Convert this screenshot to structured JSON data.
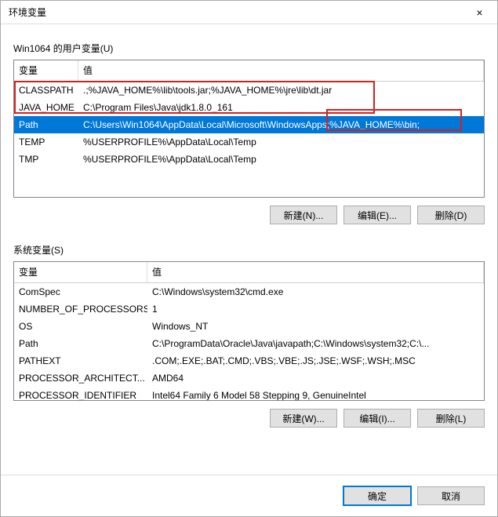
{
  "window": {
    "title": "环境变量",
    "close": "×"
  },
  "user_section": {
    "label": "Win1064 的用户变量(U)",
    "col_var": "变量",
    "col_val": "值",
    "rows": [
      {
        "var": "CLASSPATH",
        "val": ".;%JAVA_HOME%\\lib\\tools.jar;%JAVA_HOME%\\jre\\lib\\dt.jar",
        "selected": false
      },
      {
        "var": "JAVA_HOME",
        "val": "C:\\Program Files\\Java\\jdk1.8.0_161",
        "selected": false
      },
      {
        "var": "Path",
        "val": "C:\\Users\\Win1064\\AppData\\Local\\Microsoft\\WindowsApps;%JAVA_HOME%\\bin;",
        "selected": true
      },
      {
        "var": "TEMP",
        "val": "%USERPROFILE%\\AppData\\Local\\Temp",
        "selected": false
      },
      {
        "var": "TMP",
        "val": "%USERPROFILE%\\AppData\\Local\\Temp",
        "selected": false
      }
    ],
    "buttons": {
      "new": "新建(N)...",
      "edit": "编辑(E)...",
      "delete": "删除(D)"
    }
  },
  "system_section": {
    "label": "系统变量(S)",
    "col_var": "变量",
    "col_val": "值",
    "rows": [
      {
        "var": "ComSpec",
        "val": "C:\\Windows\\system32\\cmd.exe"
      },
      {
        "var": "NUMBER_OF_PROCESSORS",
        "val": "1"
      },
      {
        "var": "OS",
        "val": "Windows_NT"
      },
      {
        "var": "Path",
        "val": "C:\\ProgramData\\Oracle\\Java\\javapath;C:\\Windows\\system32;C:\\..."
      },
      {
        "var": "PATHEXT",
        "val": ".COM;.EXE;.BAT;.CMD;.VBS;.VBE;.JS;.JSE;.WSF;.WSH;.MSC"
      },
      {
        "var": "PROCESSOR_ARCHITECT...",
        "val": "AMD64"
      },
      {
        "var": "PROCESSOR_IDENTIFIER",
        "val": "Intel64 Family 6 Model 58 Stepping 9, GenuineIntel"
      }
    ],
    "buttons": {
      "new": "新建(W)...",
      "edit": "编辑(I)...",
      "delete": "删除(L)"
    }
  },
  "footer": {
    "ok": "确定",
    "cancel": "取消"
  }
}
